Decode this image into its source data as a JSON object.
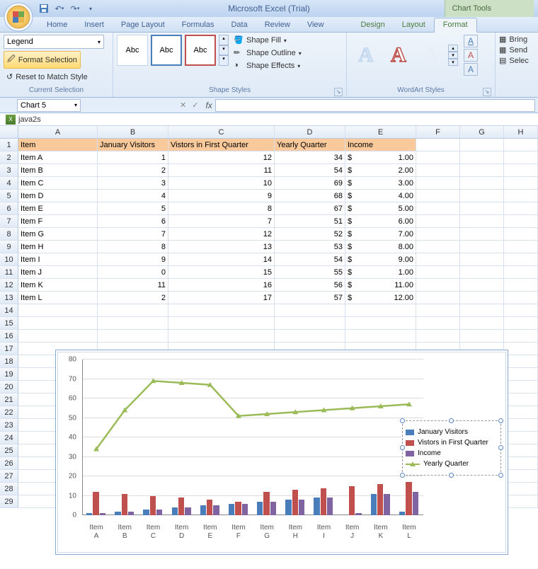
{
  "app_title": "Microsoft Excel (Trial)",
  "chart_tools_label": "Chart Tools",
  "tabs": {
    "home": "Home",
    "insert": "Insert",
    "page_layout": "Page Layout",
    "formulas": "Formulas",
    "data": "Data",
    "review": "Review",
    "view": "View",
    "design": "Design",
    "layout": "Layout",
    "format": "Format"
  },
  "ribbon": {
    "selection": {
      "combo": "Legend",
      "format_selection": "Format Selection",
      "reset": "Reset to Match Style",
      "group": "Current Selection"
    },
    "shapes": {
      "swatch": "Abc",
      "fill": "Shape Fill",
      "outline": "Shape Outline",
      "effects": "Shape Effects",
      "group": "Shape Styles"
    },
    "wordart": {
      "letter": "A",
      "group": "WordArt Styles"
    },
    "arrange": {
      "bring": "Bring",
      "send": "Send",
      "select": "Selec"
    }
  },
  "namebox": "Chart 5",
  "docname": "java2s",
  "columns": [
    "A",
    "B",
    "C",
    "D",
    "E",
    "F",
    "G",
    "H"
  ],
  "headers": {
    "A": "Item",
    "B": "January Visitors",
    "C": "Vistors in First Quarter",
    "D": "Yearly Quarter",
    "E": "Income"
  },
  "rows": [
    {
      "n": 2,
      "A": "Item A",
      "B": "1",
      "C": "12",
      "D": "34",
      "E_cur": "$",
      "E_val": "1.00"
    },
    {
      "n": 3,
      "A": "Item B",
      "B": "2",
      "C": "11",
      "D": "54",
      "E_cur": "$",
      "E_val": "2.00"
    },
    {
      "n": 4,
      "A": "Item C",
      "B": "3",
      "C": "10",
      "D": "69",
      "E_cur": "$",
      "E_val": "3.00"
    },
    {
      "n": 5,
      "A": "Item D",
      "B": "4",
      "C": "9",
      "D": "68",
      "E_cur": "$",
      "E_val": "4.00"
    },
    {
      "n": 6,
      "A": "Item E",
      "B": "5",
      "C": "8",
      "D": "67",
      "E_cur": "$",
      "E_val": "5.00"
    },
    {
      "n": 7,
      "A": "Item F",
      "B": "6",
      "C": "7",
      "D": "51",
      "E_cur": "$",
      "E_val": "6.00"
    },
    {
      "n": 8,
      "A": "Item G",
      "B": "7",
      "C": "12",
      "D": "52",
      "E_cur": "$",
      "E_val": "7.00"
    },
    {
      "n": 9,
      "A": "Item H",
      "B": "8",
      "C": "13",
      "D": "53",
      "E_cur": "$",
      "E_val": "8.00"
    },
    {
      "n": 10,
      "A": "Item I",
      "B": "9",
      "C": "14",
      "D": "54",
      "E_cur": "$",
      "E_val": "9.00"
    },
    {
      "n": 11,
      "A": "Item J",
      "B": "0",
      "C": "15",
      "D": "55",
      "E_cur": "$",
      "E_val": "1.00"
    },
    {
      "n": 12,
      "A": "Item K",
      "B": "11",
      "C": "16",
      "D": "56",
      "E_cur": "$",
      "E_val": "11.00"
    },
    {
      "n": 13,
      "A": "Item L",
      "B": "2",
      "C": "17",
      "D": "57",
      "E_cur": "$",
      "E_val": "12.00"
    }
  ],
  "empty_rows": [
    14,
    15,
    16,
    17,
    18,
    19,
    20,
    21,
    22,
    23,
    24,
    25,
    26,
    27,
    28,
    29
  ],
  "chart_data": {
    "type": "bar+line",
    "categories": [
      "Item A",
      "Item B",
      "Item C",
      "Item D",
      "Item E",
      "Item F",
      "Item G",
      "Item H",
      "Item I",
      "Item J",
      "Item K",
      "Item L"
    ],
    "series": [
      {
        "name": "January Visitors",
        "type": "bar",
        "color": "#4a7ebb",
        "values": [
          1,
          2,
          3,
          4,
          5,
          6,
          7,
          8,
          9,
          0,
          11,
          2
        ]
      },
      {
        "name": "Vistors in First Quarter",
        "type": "bar",
        "color": "#c0504d",
        "values": [
          12,
          11,
          10,
          9,
          8,
          7,
          12,
          13,
          14,
          15,
          16,
          17
        ]
      },
      {
        "name": "Income",
        "type": "bar",
        "color": "#8064a2",
        "values": [
          1,
          2,
          3,
          4,
          5,
          6,
          7,
          8,
          9,
          1,
          11,
          12
        ]
      },
      {
        "name": "Yearly Quarter",
        "type": "line",
        "color": "#9bbb59",
        "values": [
          34,
          54,
          69,
          68,
          67,
          51,
          52,
          53,
          54,
          55,
          56,
          57
        ]
      }
    ],
    "ylim": [
      0,
      80
    ],
    "yticks": [
      0,
      10,
      20,
      30,
      40,
      50,
      60,
      70,
      80
    ],
    "legend_entries": [
      "January Visitors",
      "Vistors in First Quarter",
      "Income",
      "Yearly Quarter"
    ]
  }
}
